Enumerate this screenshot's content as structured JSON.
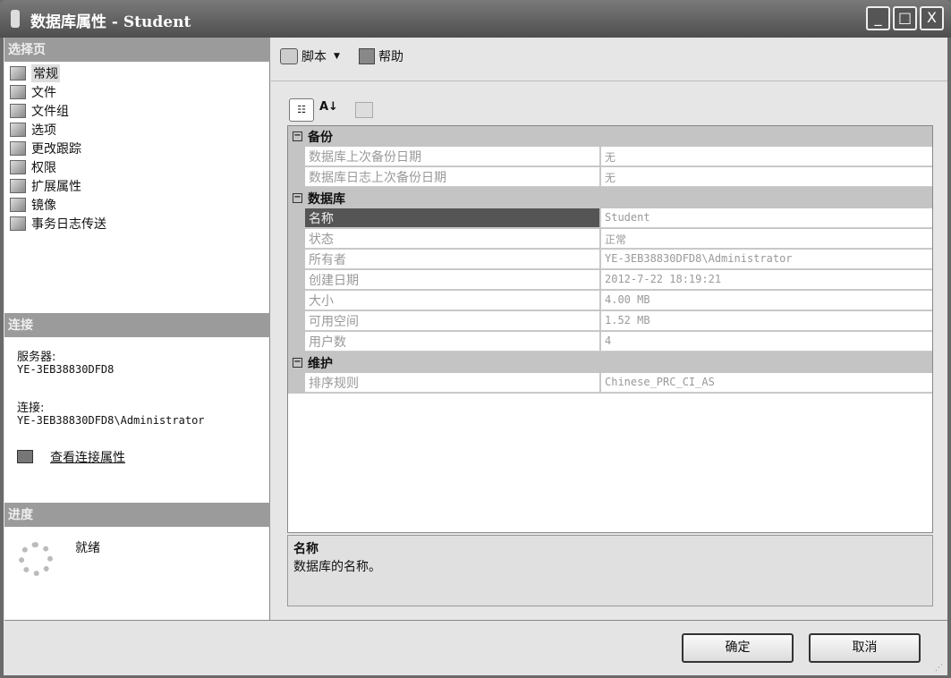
{
  "window": {
    "title": "数据库属性 - Student",
    "minimize": "_",
    "maximize": "□",
    "close": "X"
  },
  "left": {
    "select_page_header": "选择页",
    "pages": [
      "常规",
      "文件",
      "文件组",
      "选项",
      "更改跟踪",
      "权限",
      "扩展属性",
      "镜像",
      "事务日志传送"
    ],
    "connection_header": "连接",
    "server_label": "服务器:",
    "server_value": "YE-3EB38830DFD8",
    "connection_label": "连接:",
    "connection_value": "YE-3EB38830DFD8\\Administrator",
    "view_conn_props": "查看连接属性",
    "progress_header": "进度",
    "progress_status": "就绪"
  },
  "toolbar": {
    "script": "脚本",
    "help": "帮助"
  },
  "grid": {
    "categories": [
      {
        "name": "备份",
        "rows": [
          [
            "数据库上次备份日期",
            "无"
          ],
          [
            "数据库日志上次备份日期",
            "无"
          ]
        ]
      },
      {
        "name": "数据库",
        "rows": [
          [
            "名称",
            "Student"
          ],
          [
            "状态",
            "正常"
          ],
          [
            "所有者",
            "YE-3EB38830DFD8\\Administrator"
          ],
          [
            "创建日期",
            "2012-7-22 18:19:21"
          ],
          [
            "大小",
            "4.00 MB"
          ],
          [
            "可用空间",
            "1.52 MB"
          ],
          [
            "用户数",
            "4"
          ]
        ]
      },
      {
        "name": "维护",
        "rows": [
          [
            "排序规则",
            "Chinese_PRC_CI_AS"
          ]
        ]
      }
    ],
    "selected": "名称"
  },
  "description": {
    "title": "名称",
    "text": "数据库的名称。"
  },
  "buttons": {
    "ok": "确定",
    "cancel": "取消"
  }
}
